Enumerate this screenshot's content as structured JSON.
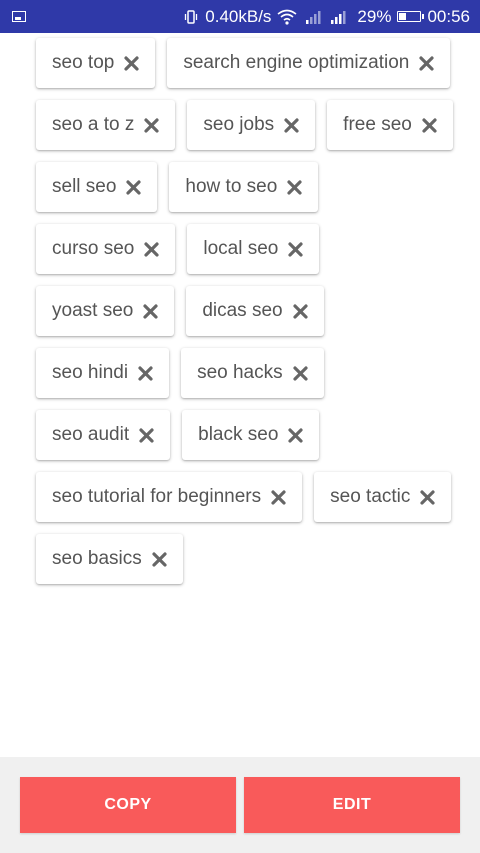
{
  "status_bar": {
    "speed": "0.40kB/s",
    "battery_percent": "29%",
    "time": "00:56",
    "icons": [
      "notification-icon",
      "vibrate-icon",
      "wifi-icon",
      "signal-icon",
      "signal-icon",
      "battery-icon"
    ],
    "battery_level": 0.29
  },
  "chips": [
    {
      "label": "seo top"
    },
    {
      "label": "search engine optimization"
    },
    {
      "label": "seo a to z"
    },
    {
      "label": "seo jobs"
    },
    {
      "label": "free seo"
    },
    {
      "label": "sell seo"
    },
    {
      "label": "how to seo"
    },
    {
      "label": "curso seo"
    },
    {
      "label": "local seo"
    },
    {
      "label": "yoast seo"
    },
    {
      "label": "dicas seo"
    },
    {
      "label": "seo hindi"
    },
    {
      "label": "seo hacks"
    },
    {
      "label": "seo audit"
    },
    {
      "label": "black seo"
    },
    {
      "label": "seo tutorial for beginners"
    },
    {
      "label": "seo tactic"
    },
    {
      "label": "seo basics"
    }
  ],
  "actions": {
    "copy_label": "COPY",
    "edit_label": "EDIT"
  },
  "colors": {
    "status_bar": "#2f39a8",
    "button": "#f95a5a",
    "chip_text": "#555555"
  }
}
